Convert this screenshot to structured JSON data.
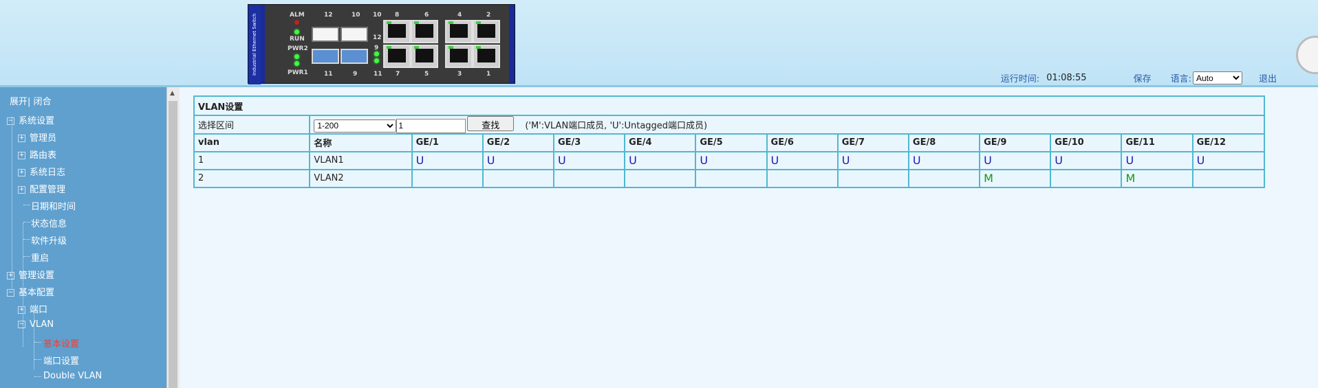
{
  "device": {
    "brand_text": "Industrial Ethernet Switch",
    "leds": {
      "alm": "ALM",
      "run": "RUN",
      "pwr2": "PWR2",
      "pwr1": "PWR1"
    },
    "top_port_numbers": [
      "12",
      "10",
      "10",
      "8",
      "6",
      "4",
      "2"
    ],
    "bottom_port_numbers": [
      "11",
      "9",
      "11",
      "7",
      "5",
      "3",
      "1"
    ],
    "side_numbers": [
      "12",
      "9"
    ]
  },
  "status": {
    "uptime_label": "运行时间:",
    "uptime_value": "01:08:55",
    "save_label": "保存",
    "language_label": "语言:",
    "language_value": "Auto",
    "logout_label": "退出"
  },
  "sidebar": {
    "expand": "展开",
    "separator": "|",
    "collapse": "闭合",
    "items": [
      {
        "label": "系统设置",
        "icon": "minus"
      },
      {
        "label": "管理员",
        "icon": "plus"
      },
      {
        "label": "路由表",
        "icon": "plus"
      },
      {
        "label": "系统日志",
        "icon": "plus"
      },
      {
        "label": "配置管理",
        "icon": "plus"
      },
      {
        "label": "日期和时间",
        "icon": ""
      },
      {
        "label": "状态信息",
        "icon": ""
      },
      {
        "label": "软件升级",
        "icon": ""
      },
      {
        "label": "重启",
        "icon": ""
      },
      {
        "label": "管理设置",
        "icon": "plus"
      },
      {
        "label": "基本配置",
        "icon": "minus"
      },
      {
        "label": "端口",
        "icon": "plus"
      },
      {
        "label": "VLAN",
        "icon": "minus"
      },
      {
        "label": "基本设置",
        "icon": "",
        "active": true
      },
      {
        "label": "端口设置",
        "icon": ""
      },
      {
        "label": "Double VLAN",
        "icon": ""
      }
    ]
  },
  "vlan": {
    "title": "VLAN设置",
    "range_label": "选择区间",
    "range_value": "1-200",
    "range_input": "1",
    "find_button": "查找",
    "hint": "('M':VLAN端口成员, 'U':Untagged端口成员)",
    "headers": [
      "vlan",
      "名称",
      "GE/1",
      "GE/2",
      "GE/3",
      "GE/4",
      "GE/5",
      "GE/6",
      "GE/7",
      "GE/8",
      "GE/9",
      "GE/10",
      "GE/11",
      "GE/12"
    ],
    "rows": [
      {
        "id": "1",
        "name": "VLAN1",
        "ports": [
          "U",
          "U",
          "U",
          "U",
          "U",
          "U",
          "U",
          "U",
          "U",
          "U",
          "U",
          "U"
        ]
      },
      {
        "id": "2",
        "name": "VLAN2",
        "ports": [
          "",
          "",
          "",
          "",
          "",
          "",
          "",
          "",
          "M",
          "",
          "M",
          ""
        ]
      }
    ]
  }
}
